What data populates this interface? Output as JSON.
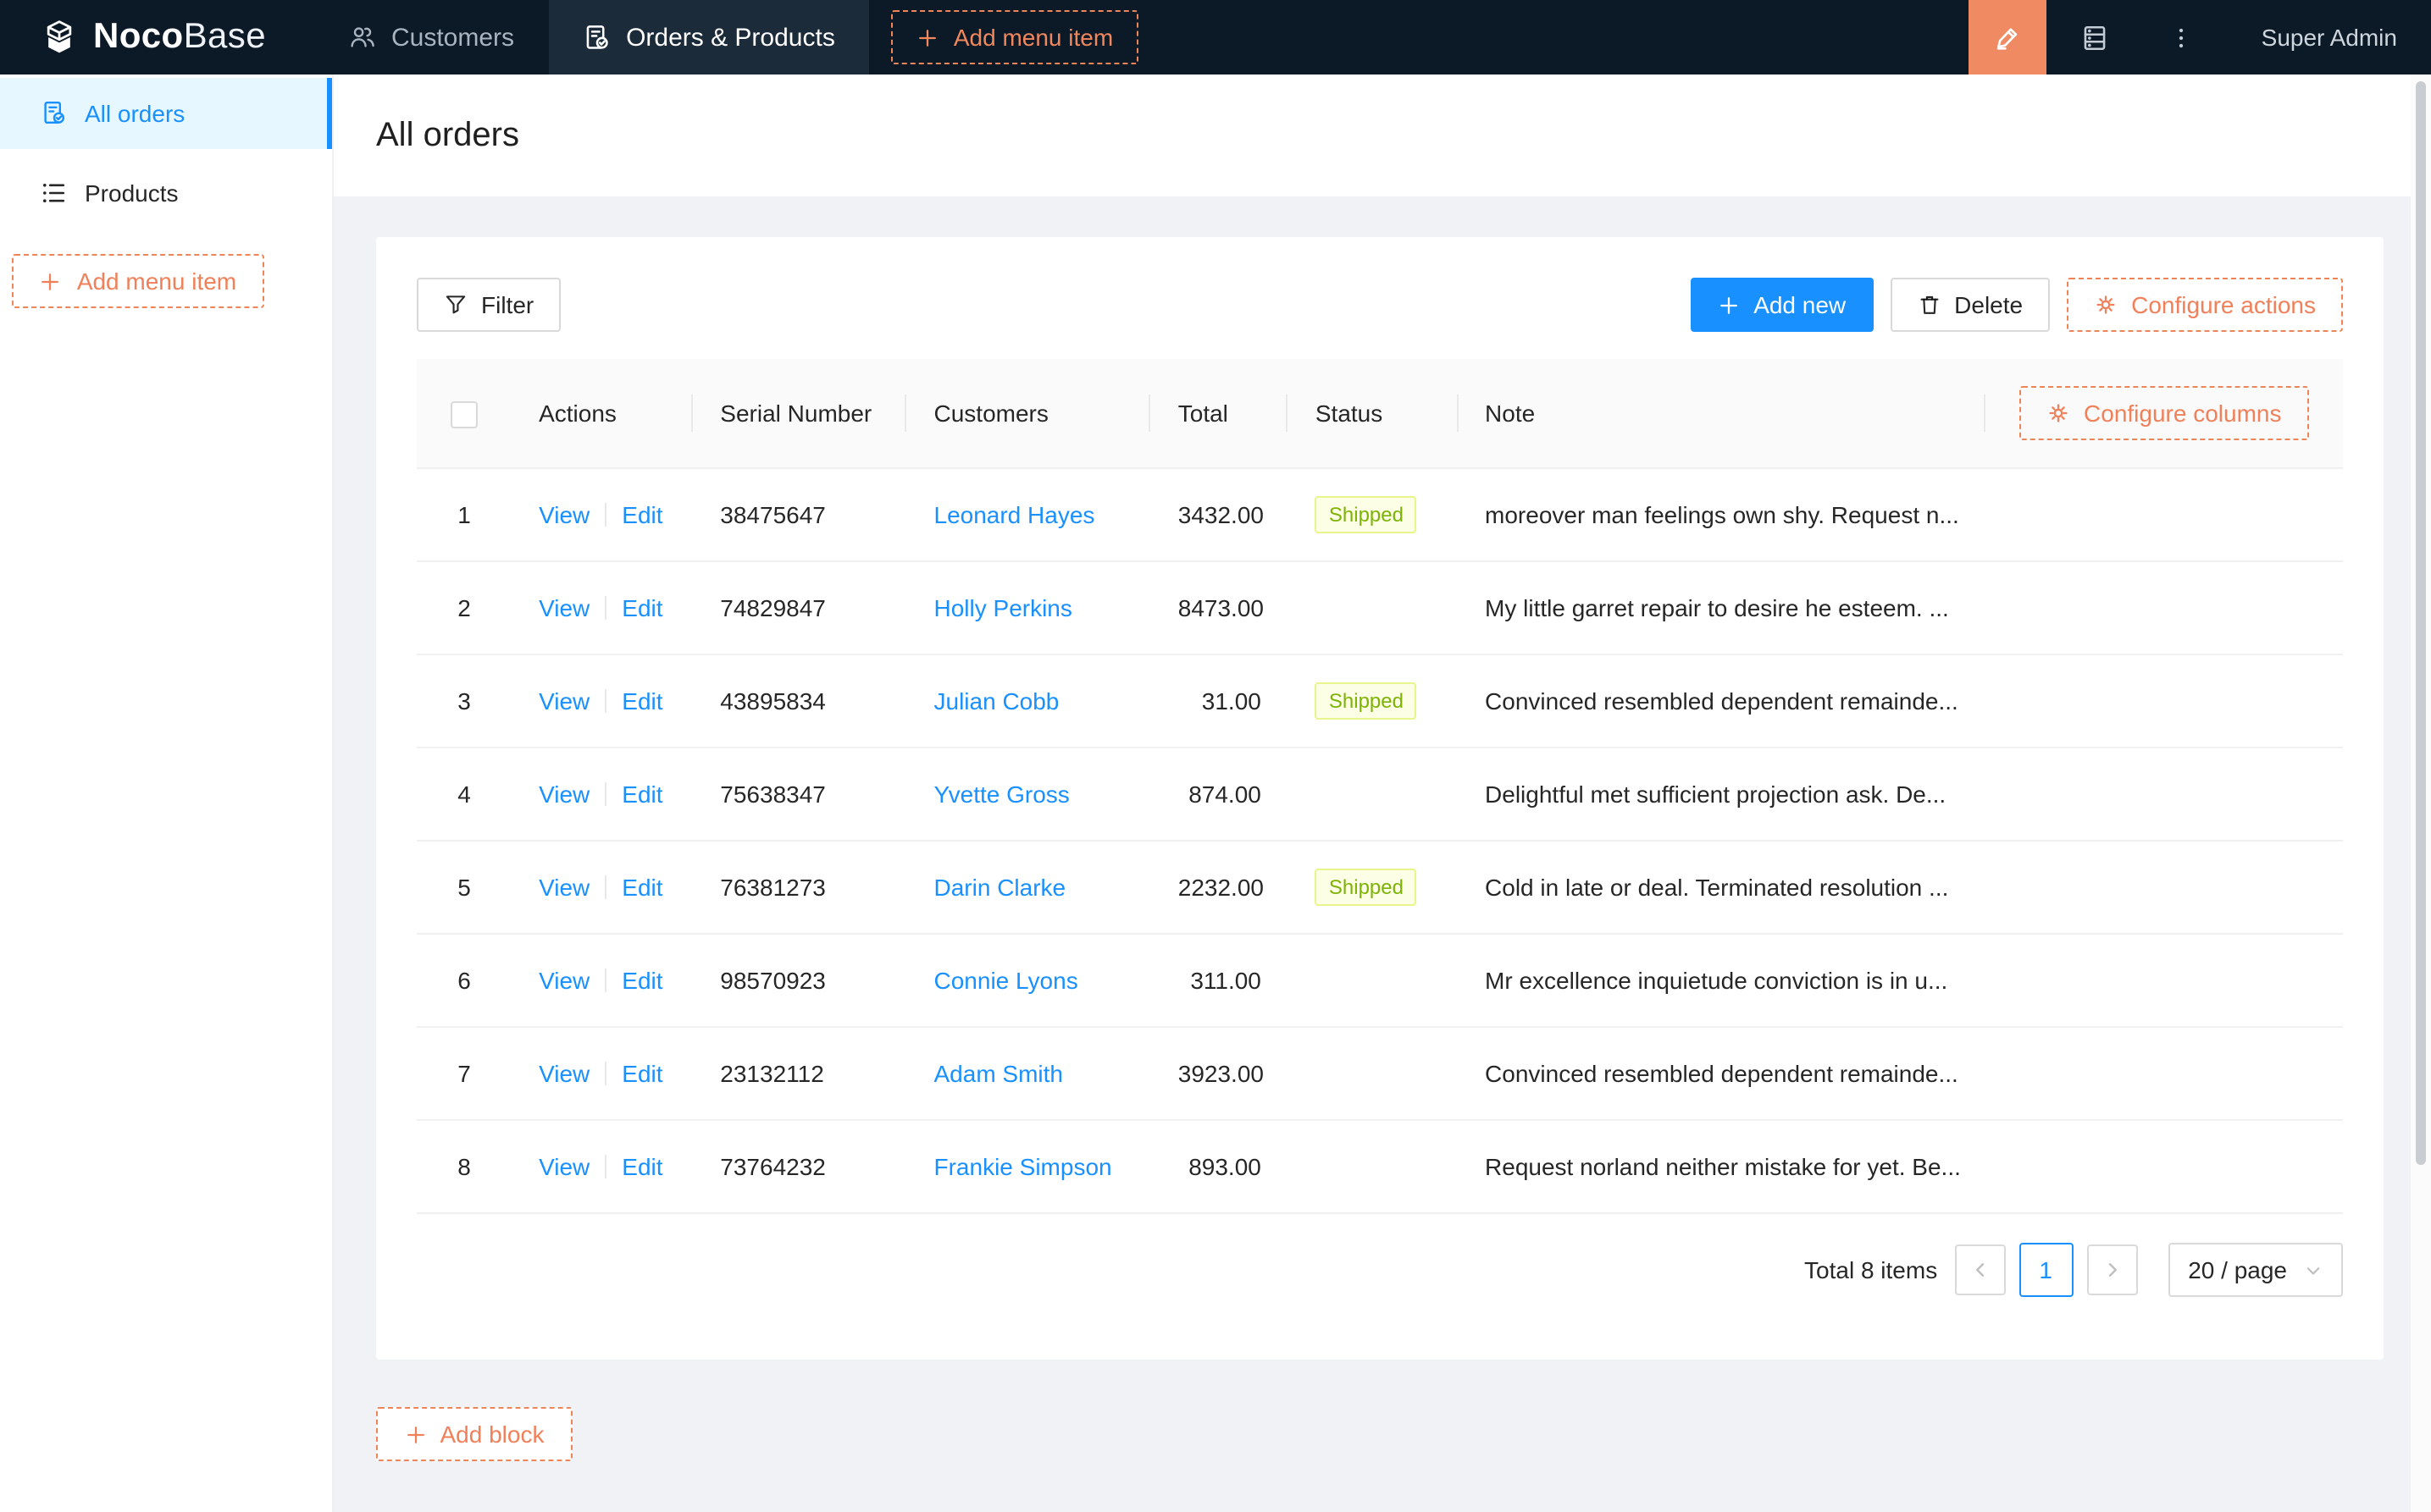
{
  "navbar": {
    "logo": {
      "bold": "Noco",
      "light": "Base"
    },
    "tabs": [
      {
        "label": "Customers"
      },
      {
        "label": "Orders & Products"
      }
    ],
    "add_menu_item_label": "Add menu item",
    "user": "Super Admin"
  },
  "sidebar": {
    "items": [
      {
        "label": "All orders"
      },
      {
        "label": "Products"
      }
    ],
    "add_menu_item_label": "Add menu item"
  },
  "page": {
    "title": "All orders"
  },
  "toolbar": {
    "filter": "Filter",
    "add_new": "Add new",
    "delete": "Delete",
    "configure_actions": "Configure actions"
  },
  "table": {
    "configure_columns": "Configure columns",
    "columns": [
      "Actions",
      "Serial Number",
      "Customers",
      "Total",
      "Status",
      "Note"
    ],
    "actions": {
      "view": "View",
      "edit": "Edit"
    },
    "rows": [
      {
        "index": "1",
        "serial": "38475647",
        "customer": "Leonard Hayes",
        "total": "3432.00",
        "status": "Shipped",
        "note": "moreover man feelings own shy. Request n..."
      },
      {
        "index": "2",
        "serial": "74829847",
        "customer": "Holly Perkins",
        "total": "8473.00",
        "status": "",
        "note": "My little garret repair to desire he esteem. ..."
      },
      {
        "index": "3",
        "serial": "43895834",
        "customer": "Julian Cobb",
        "total": "31.00",
        "status": "Shipped",
        "note": "Convinced resembled dependent remainde..."
      },
      {
        "index": "4",
        "serial": "75638347",
        "customer": "Yvette Gross",
        "total": "874.00",
        "status": "",
        "note": "Delightful met sufficient projection ask. De..."
      },
      {
        "index": "5",
        "serial": "76381273",
        "customer": "Darin Clarke",
        "total": "2232.00",
        "status": "Shipped",
        "note": "Cold in late or deal. Terminated resolution ..."
      },
      {
        "index": "6",
        "serial": "98570923",
        "customer": "Connie Lyons",
        "total": "311.00",
        "status": "",
        "note": "Mr excellence inquietude conviction is in u..."
      },
      {
        "index": "7",
        "serial": "23132112",
        "customer": "Adam Smith",
        "total": "3923.00",
        "status": "",
        "note": "Convinced resembled dependent remainde..."
      },
      {
        "index": "8",
        "serial": "73764232",
        "customer": "Frankie Simpson",
        "total": "893.00",
        "status": "",
        "note": "Request norland neither mistake for yet. Be..."
      }
    ]
  },
  "pagination": {
    "total": "Total 8 items",
    "page": "1",
    "page_size": "20 / page"
  },
  "add_block_label": "Add block",
  "colors": {
    "accent_orange": "#f0805a",
    "editor_button_bg": "#ef8a63",
    "primary_blue": "#1890ff",
    "navbar_bg": "#0c1a28",
    "active_tab_bg": "#1b2b3a",
    "sidebar_active_bg": "#e6f7ff",
    "content_bg": "#f0f2f5",
    "table_header_bg": "#fafafa",
    "badge_bg": "#fcffe6",
    "badge_border": "#e8f58c",
    "badge_text": "#7cb305"
  }
}
